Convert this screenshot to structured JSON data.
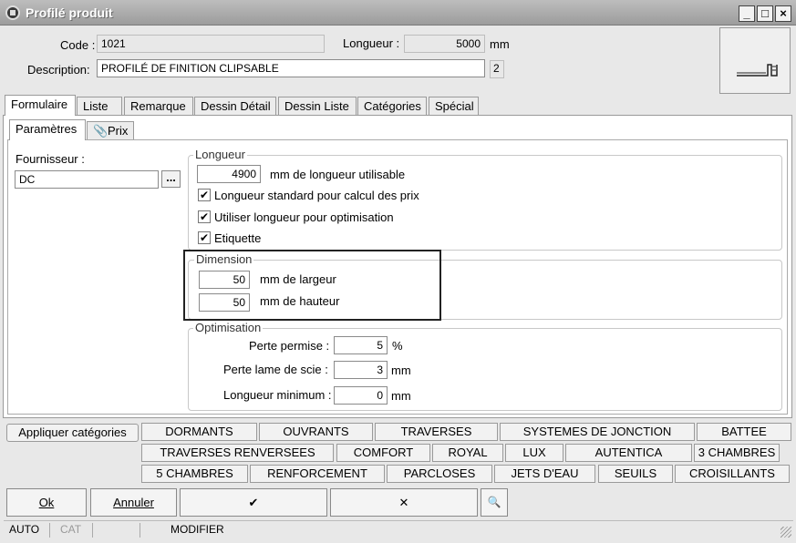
{
  "window": {
    "title": "Profilé produit",
    "minimize": "_",
    "maximize": "□",
    "close": "×"
  },
  "header": {
    "code_label": "Code :",
    "code_value": "1021",
    "longueur_label": "Longueur :",
    "longueur_value": "5000",
    "longueur_unit": "mm",
    "description_label": "Description:",
    "description_value": "PROFILÉ DE FINITION CLIPSABLE",
    "desc_badge": "2"
  },
  "tabs": [
    "Formulaire",
    "Liste",
    "Remarque",
    "Dessin Détail",
    "Dessin Liste",
    "Catégories",
    "Spécial"
  ],
  "subtabs": [
    "Paramètres",
    "Prix"
  ],
  "fournisseur": {
    "label": "Fournisseur :",
    "value": "DC",
    "browse": "..."
  },
  "longueur_group": {
    "title": "Longueur",
    "value": "4900",
    "unit_label": "mm de longueur utilisable",
    "checkboxes": [
      {
        "label": "Longueur standard pour calcul des prix",
        "checked": true
      },
      {
        "label": "Utiliser longueur pour optimisation",
        "checked": true
      },
      {
        "label": "Etiquette",
        "checked": true
      }
    ]
  },
  "dimension_group": {
    "title": "Dimension",
    "largeur_value": "50",
    "largeur_label": "mm de largeur",
    "hauteur_value": "50",
    "hauteur_label": "mm de hauteur"
  },
  "optimisation_group": {
    "title": "Optimisation",
    "perte_label": "Perte permise :",
    "perte_value": "5",
    "perte_unit": "%",
    "lame_label": "Perte lame de scie :",
    "lame_value": "3",
    "lame_unit": "mm",
    "min_label": "Longueur minimum :",
    "min_value": "0",
    "min_unit": "mm"
  },
  "categories": {
    "apply_label": "Appliquer catégories",
    "row1": [
      "DORMANTS",
      "OUVRANTS",
      "TRAVERSES",
      "SYSTEMES DE JONCTION",
      "BATTEE"
    ],
    "row2": [
      "TRAVERSES RENVERSEES",
      "COMFORT",
      "ROYAL",
      "LUX",
      "AUTENTICA",
      "3 CHAMBRES"
    ],
    "row3": [
      "5 CHAMBRES",
      "RENFORCEMENT",
      "PARCLOSES",
      "JETS D'EAU",
      "SEUILS",
      "CROISILLANTS"
    ]
  },
  "buttons": {
    "ok": "Ok",
    "annuler": "Annuler",
    "check": "✔",
    "cross": "✕",
    "find": "🔍"
  },
  "statusbar": [
    "AUTO",
    "CAT",
    "",
    "MODIFIER"
  ]
}
